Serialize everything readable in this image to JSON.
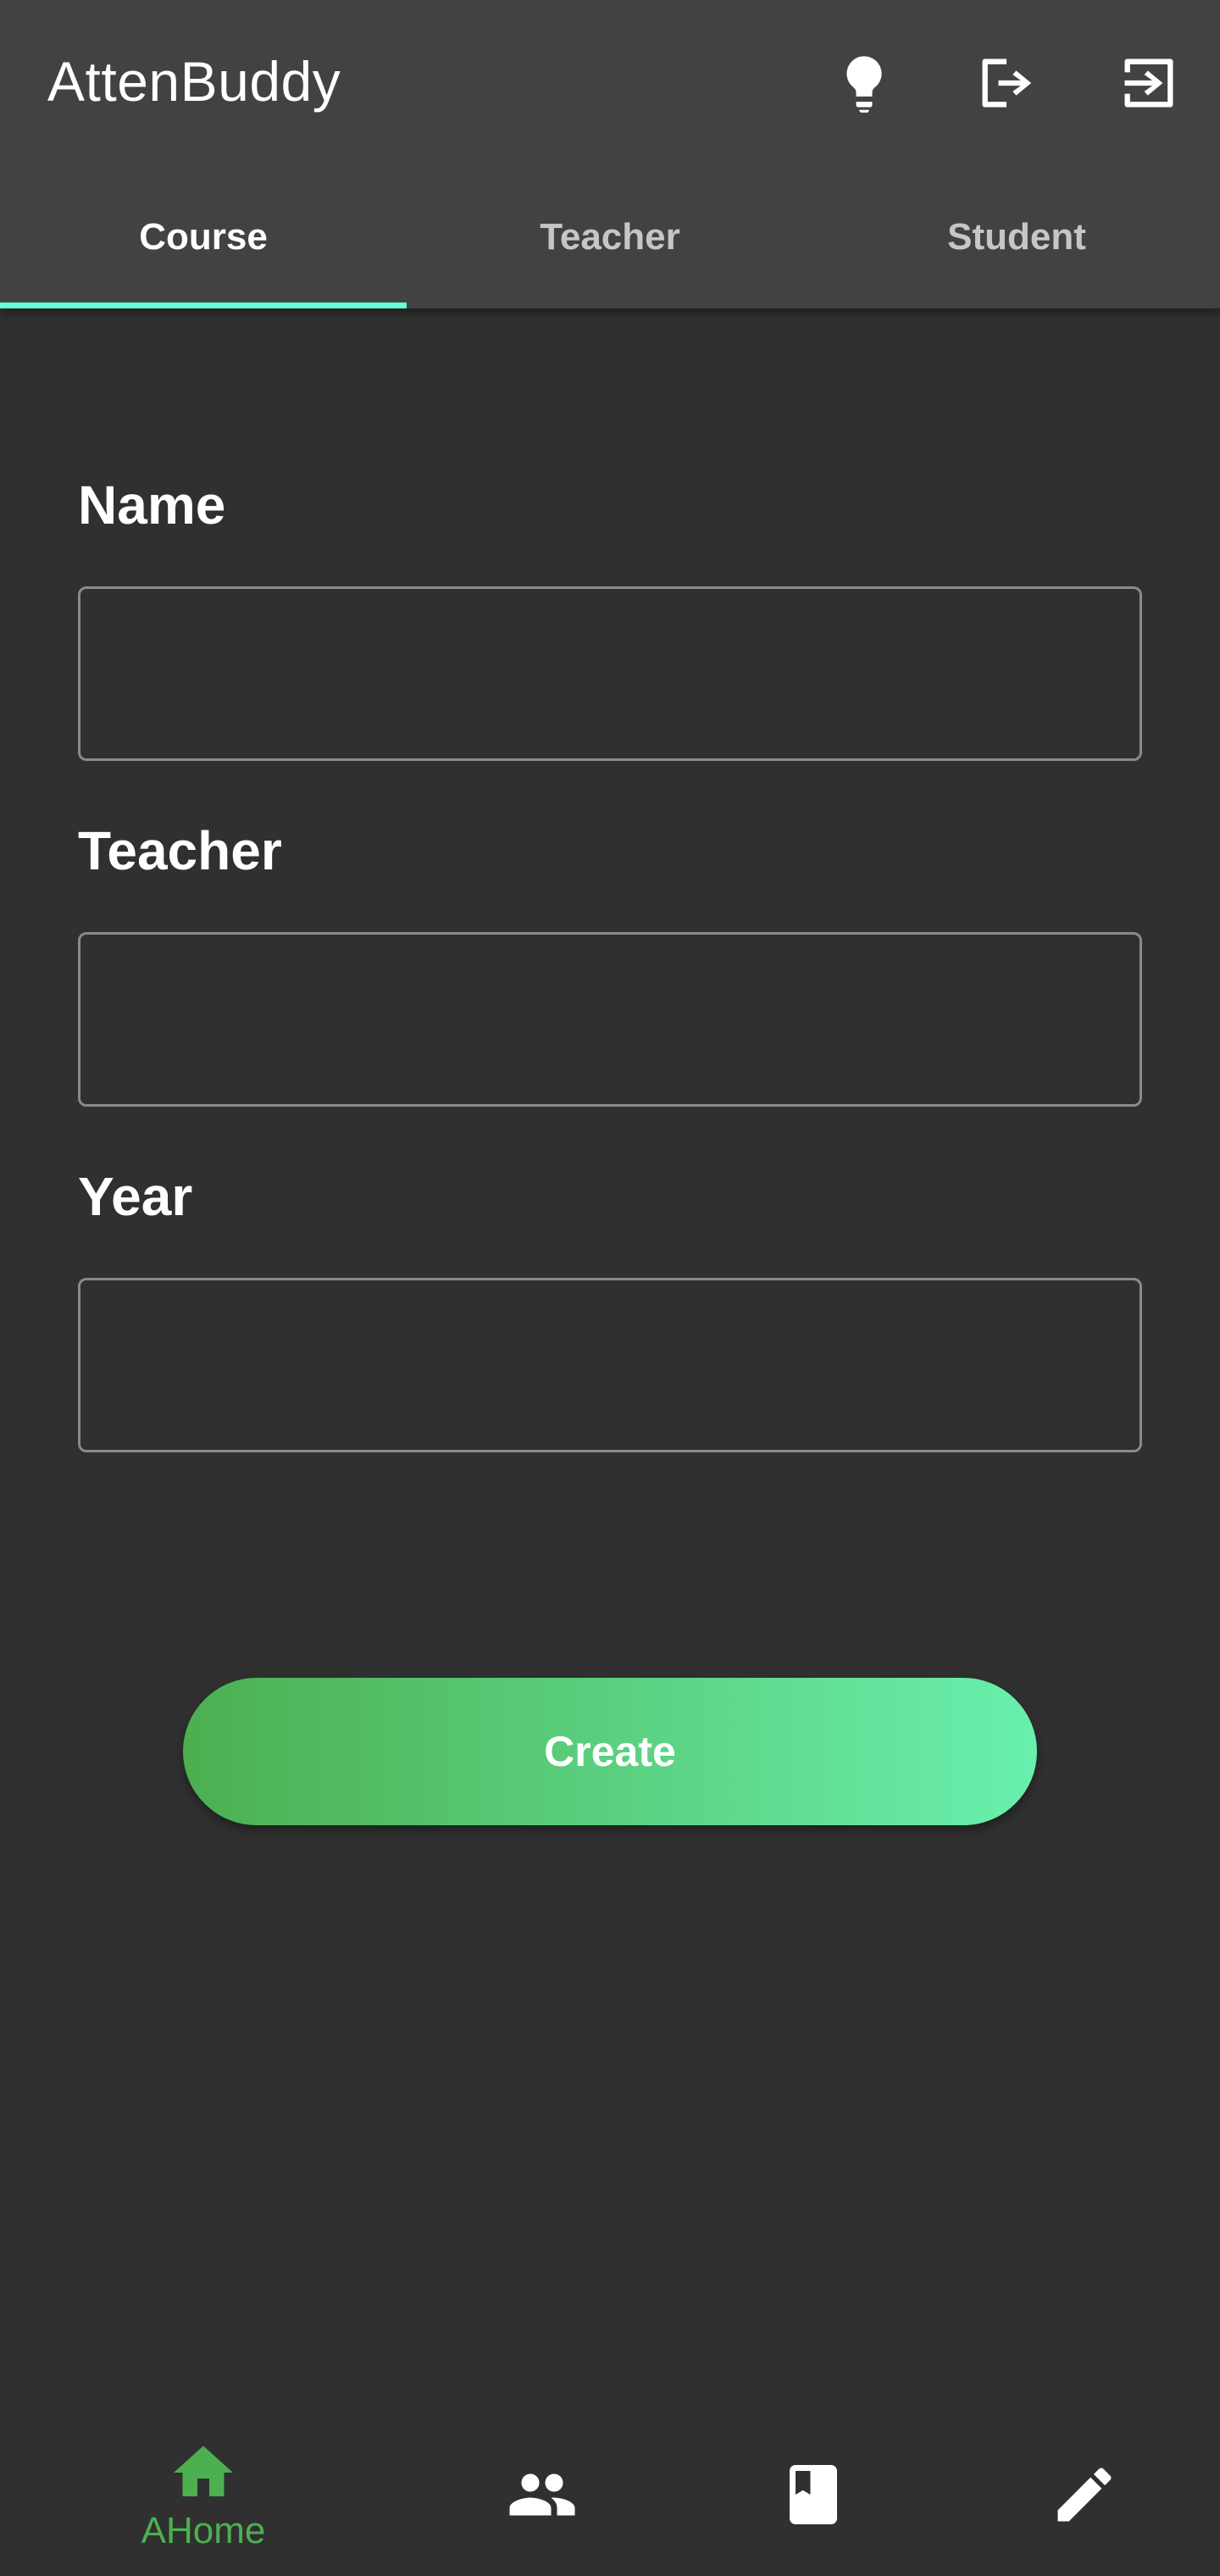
{
  "app": {
    "title": "AttenBuddy",
    "actions": [
      {
        "icon": "lightbulb-icon"
      },
      {
        "icon": "logout-icon"
      },
      {
        "icon": "login-icon"
      }
    ]
  },
  "tabs": [
    {
      "label": "Course",
      "active": true
    },
    {
      "label": "Teacher",
      "active": false
    },
    {
      "label": "Student",
      "active": false
    }
  ],
  "form": {
    "name_label": "Name",
    "name_value": "",
    "teacher_label": "Teacher",
    "teacher_value": "",
    "year_label": "Year",
    "year_value": "",
    "create_label": "Create"
  },
  "bottom_nav": [
    {
      "icon": "home-icon",
      "label": "AHome",
      "active": true
    },
    {
      "icon": "people-icon",
      "label": "",
      "active": false
    },
    {
      "icon": "book-icon",
      "label": "",
      "active": false
    },
    {
      "icon": "pencil-icon",
      "label": "",
      "active": false
    }
  ],
  "colors": {
    "background": "#303030",
    "appbar": "#424242",
    "tab_indicator": "#64ffda",
    "accent_green": "#4caf50",
    "button_gradient_end": "#69f0ae"
  }
}
